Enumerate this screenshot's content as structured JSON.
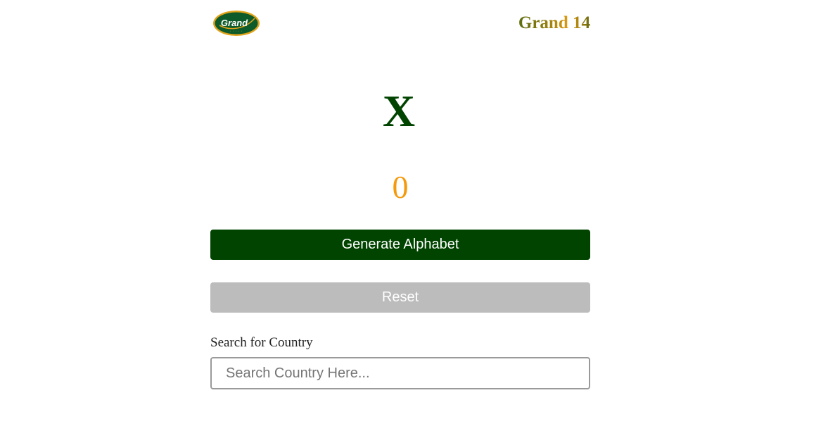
{
  "header": {
    "logo_text": "Grand",
    "title": "Grand 14"
  },
  "game": {
    "current_letter": "X",
    "count": "0"
  },
  "actions": {
    "generate_label": "Generate Alphabet",
    "reset_label": "Reset"
  },
  "search": {
    "label": "Search for Country",
    "placeholder": "Search Country Here...",
    "value": ""
  },
  "colors": {
    "brand_green": "#004400",
    "accent_orange": "#f59a0c",
    "reset_gray": "#bcbcbc"
  }
}
